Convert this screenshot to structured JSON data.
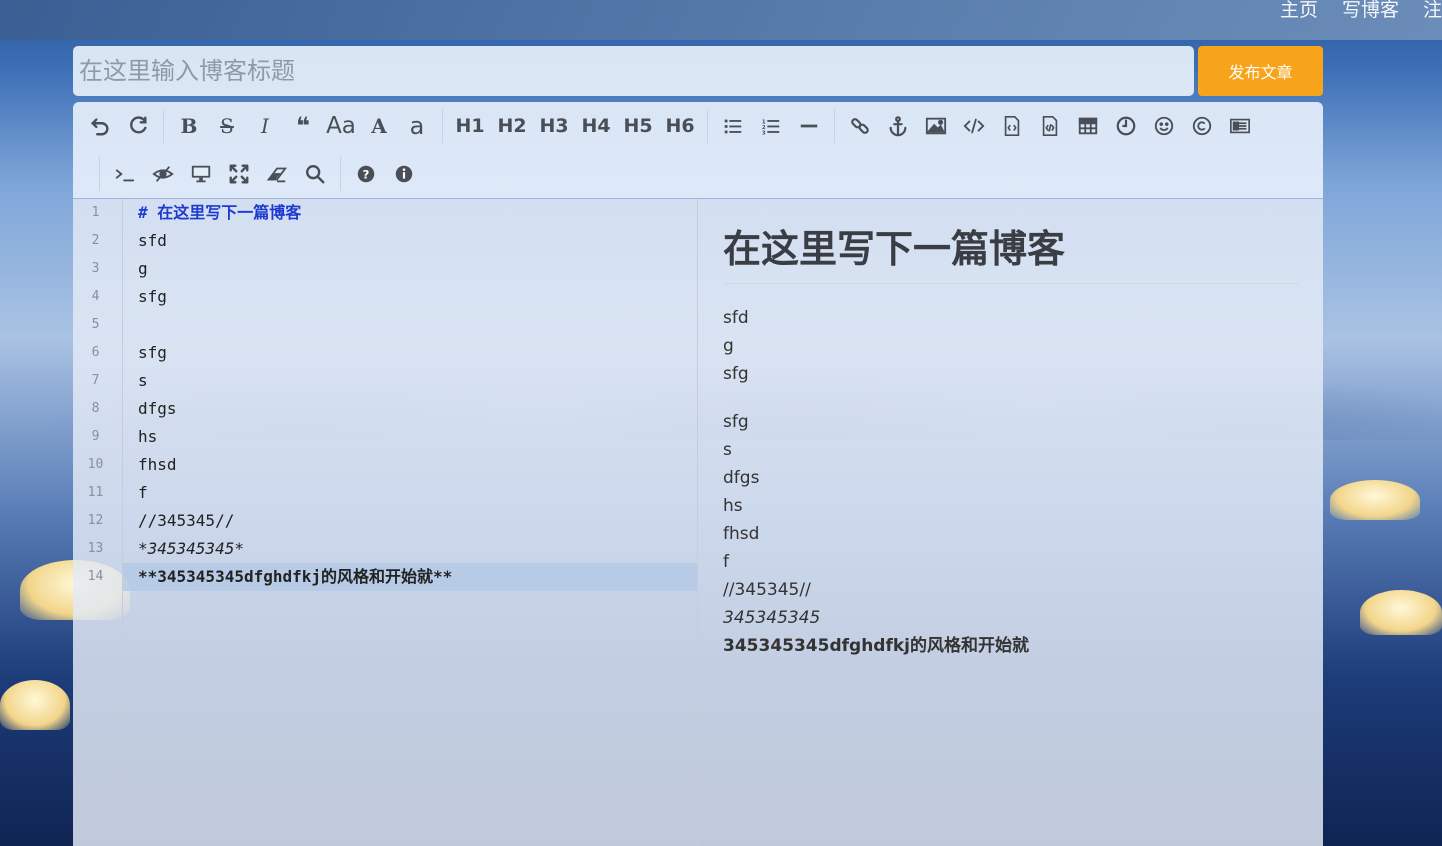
{
  "nav": {
    "links": [
      "主页",
      "写博客",
      "注"
    ]
  },
  "title_input": {
    "placeholder": "在这里输入博客标题",
    "value": ""
  },
  "publish_button": {
    "label": "发布文章"
  },
  "toolbar": {
    "row1": [
      {
        "name": "undo-icon",
        "glyph": "↶"
      },
      {
        "name": "redo-icon",
        "glyph": "↷"
      },
      {
        "name": "bold-icon",
        "glyph": "B"
      },
      {
        "name": "strikethrough-icon",
        "glyph": "S"
      },
      {
        "name": "italic-icon",
        "glyph": "I"
      },
      {
        "name": "quote-icon",
        "glyph": "❝"
      },
      {
        "name": "uppercase-icon",
        "glyph": "Aa"
      },
      {
        "name": "ucfirst-icon",
        "glyph": "A"
      },
      {
        "name": "lowercase-icon",
        "glyph": "a"
      }
    ],
    "headings": [
      "H1",
      "H2",
      "H3",
      "H4",
      "H5",
      "H6"
    ],
    "row1_rest": [
      "list-ul-icon",
      "list-ol-icon",
      "hr-icon",
      "link-icon",
      "anchor-icon",
      "image-icon",
      "code-icon",
      "preformatted-icon",
      "code-block-icon",
      "table-icon",
      "datetime-icon",
      "emoji-icon",
      "html-entities-icon",
      "pagebreak-icon"
    ],
    "row2": [
      "terminal-icon",
      "hide-icon",
      "preview-icon",
      "fullscreen-icon",
      "clear-icon",
      "search-icon",
      "help-icon",
      "info-icon"
    ]
  },
  "editor": {
    "line_numbers": [
      "1",
      "2",
      "3",
      "4",
      "5",
      "6",
      "7",
      "8",
      "9",
      "10",
      "11",
      "12",
      "13",
      "14"
    ],
    "lines": [
      "# 在这里写下一篇博客",
      "sfd",
      "g",
      "sfg",
      "",
      "sfg",
      "s",
      "dfgs",
      "hs",
      "fhsd",
      "f",
      "//345345//",
      "*345345345*",
      "**345345345dfghdfkj的风格和开始就**"
    ]
  },
  "preview": {
    "heading": "在这里写下一篇博客",
    "para1": [
      "sfd",
      "g",
      "sfg"
    ],
    "para2": [
      "sfg",
      "s",
      "dfgs",
      "hs",
      "fhsd",
      "f",
      "//345345//"
    ],
    "italic": "345345345",
    "bold": "345345345dfghdfkj的风格和开始就"
  }
}
